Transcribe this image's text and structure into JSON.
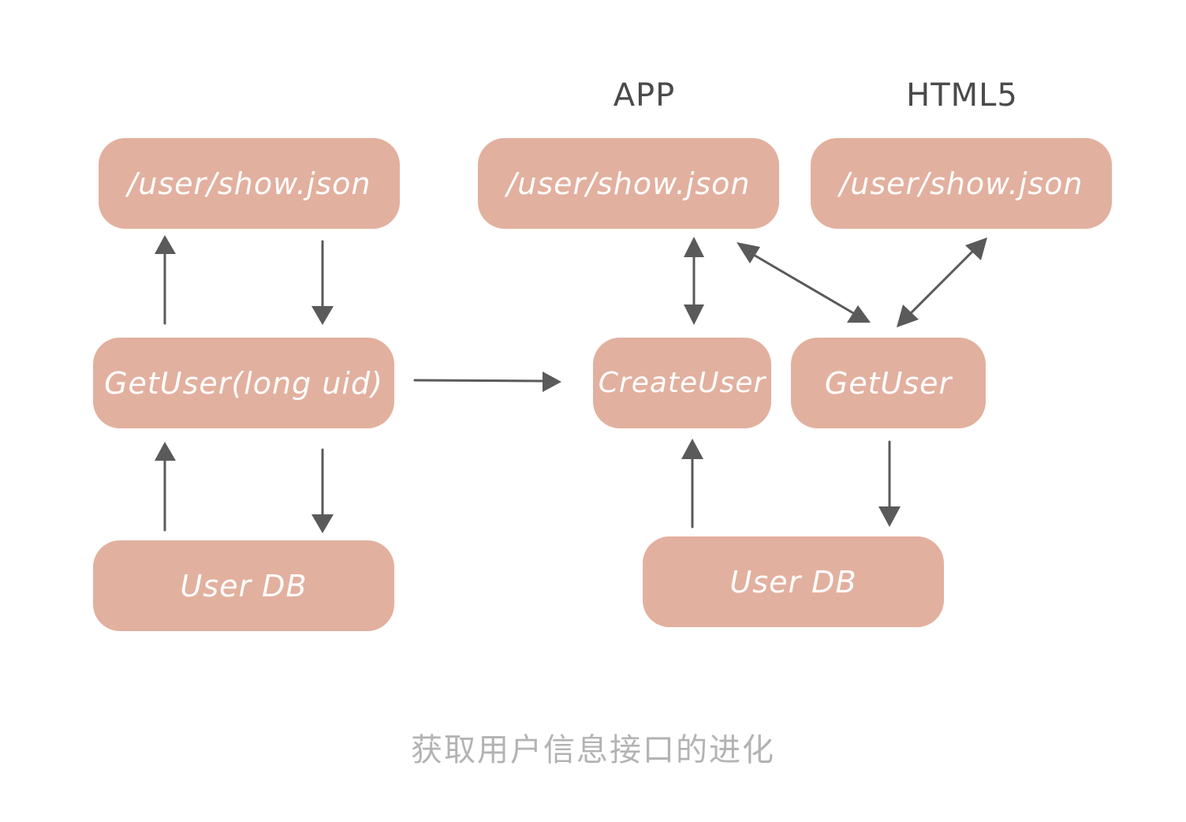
{
  "left": {
    "endpoint": "/user/show.json",
    "service": "GetUser(long uid)",
    "database": "User DB"
  },
  "right": {
    "app_label": "APP",
    "html5_label": "HTML5",
    "app_endpoint": "/user/show.json",
    "html5_endpoint": "/user/show.json",
    "create_service": "CreateUser",
    "get_service": "GetUser",
    "database": "User DB"
  },
  "caption": "获取用户信息接口的进化",
  "colors": {
    "box_fill": "#e2b09f",
    "box_text": "#ffffff",
    "arrow": "#5a5a5a",
    "caption": "#b3b3b3"
  }
}
